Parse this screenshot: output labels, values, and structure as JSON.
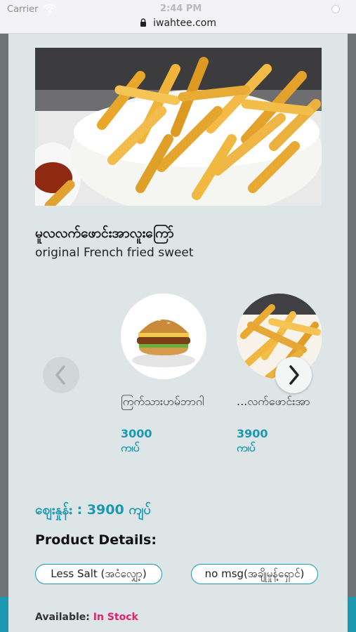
{
  "status": {
    "carrier": "Carrier",
    "time": "2:44 PM"
  },
  "browser": {
    "url": "iwahtee.com"
  },
  "product": {
    "name_my": "မူလလက်ဖောင်းအာလူးကြော်",
    "name_en": "original French fried sweet",
    "price_line": "ဈေးနှုန်း : 3900 ကျပ်"
  },
  "related": [
    {
      "name": "ကြက်သားဟမ်ဘာဂါ",
      "price": "3000 ကျပ်",
      "image": "burger"
    },
    {
      "name": "...လက်ဖောင်းအာ",
      "price": "3900 ကျပ်",
      "image": "fries"
    }
  ],
  "details": {
    "heading": "Product Details:",
    "options": [
      "Less Salt (အငံလျှော့)",
      "no msg(အချိုမှုန့်ရှောင်)"
    ],
    "availability_label": "Available: ",
    "availability_value": "In Stock"
  },
  "colors": {
    "accent": "#1b99b3",
    "stock": "#e2226b",
    "sheet": "#dde5e7"
  },
  "icons": {
    "prev": "chevron-left-icon",
    "next": "chevron-right-icon",
    "lock": "lock-icon",
    "wifi": "wifi-icon"
  }
}
